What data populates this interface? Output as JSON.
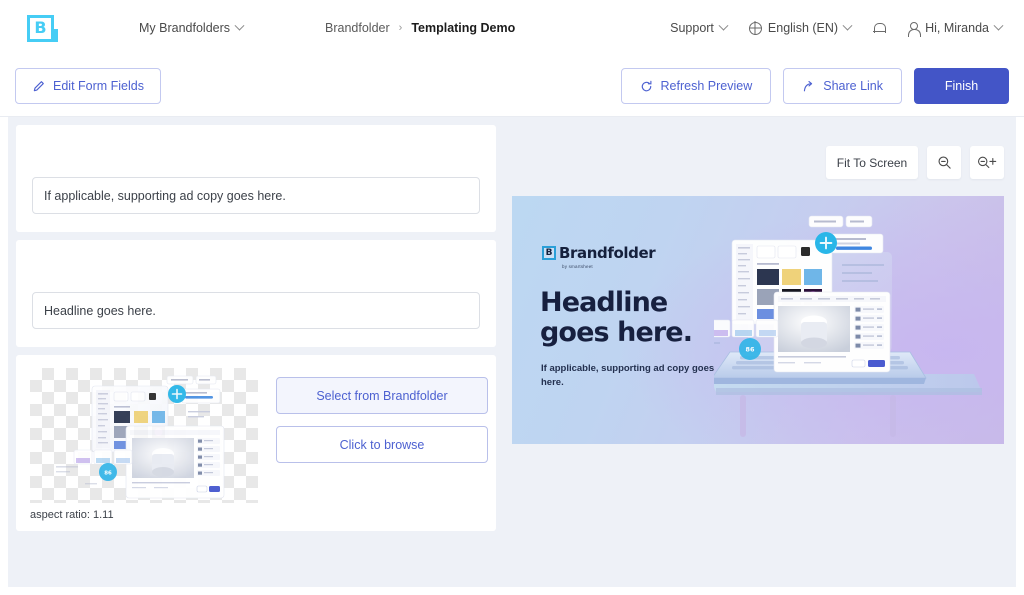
{
  "header": {
    "logo_icon": "brandfolder-logo-icon",
    "brand_initial": "B",
    "my_brandfolders": "My Brandfolders",
    "breadcrumb": {
      "root": "Brandfolder",
      "separator": "›",
      "current": "Templating Demo"
    },
    "support": "Support",
    "language": "English (EN)",
    "notifications_icon": "bell-icon",
    "account": "Hi, Miranda"
  },
  "actionbar": {
    "edit_form_fields": "Edit Form Fields",
    "edit_icon": "pencil-icon",
    "refresh_preview": "Refresh Preview",
    "refresh_icon": "refresh-icon",
    "share_link": "Share Link",
    "share_icon": "share-icon",
    "finish": "Finish"
  },
  "form": {
    "fields": [
      {
        "label": "",
        "value": "If applicable, supporting ad copy goes here.",
        "placeholder": "If applicable, supporting ad copy goes here."
      },
      {
        "label": "",
        "value": "Headline goes here.",
        "placeholder": "Headline goes here."
      }
    ],
    "image_field": {
      "aspect_ratio": "aspect ratio: 1.11",
      "select_button": "Select from Brandfolder",
      "browse_button": "Click to browse"
    }
  },
  "preview": {
    "fit_to_screen": "Fit To Screen",
    "zoom_out_icon": "zoom-out-icon",
    "zoom_in_icon": "zoom-in-icon",
    "ad": {
      "logo_initial": "B",
      "logo_text": "Brandfolder",
      "logo_subtext": "by smartsheet",
      "headline_line1": "Headline",
      "headline_line2": "goes here.",
      "body": "If applicable, supporting ad copy goes here."
    }
  },
  "colors": {
    "brand_cyan": "#46cdf5",
    "indigo": "#4355c7",
    "indigo_text": "#4d61d1",
    "canvas_bg": "#eef1f7"
  }
}
